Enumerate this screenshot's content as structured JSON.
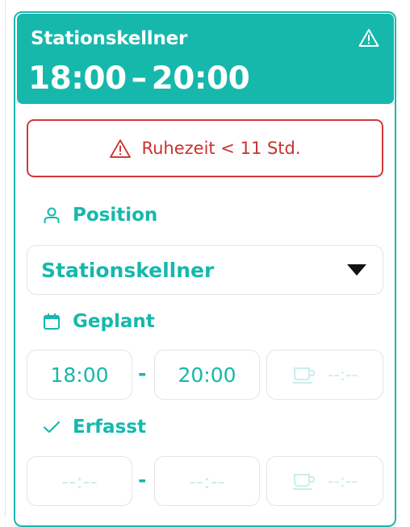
{
  "header": {
    "title": "Stationskellner",
    "time_start": "18:00",
    "time_sep": "–",
    "time_end": "20:00",
    "icon": "warning-icon"
  },
  "alert": {
    "text": "Ruhezeit < 11 Std.",
    "icon": "warning-icon"
  },
  "position": {
    "label": "Position",
    "icon": "person-icon",
    "value": "Stationskellner"
  },
  "planned": {
    "label": "Geplant",
    "icon": "calendar-icon",
    "start": "18:00",
    "sep": "-",
    "end": "20:00",
    "pause_placeholder": "--:--",
    "pause_icon": "coffee-cup-icon"
  },
  "recorded": {
    "label": "Erfasst",
    "icon": "checkmark-icon",
    "start_placeholder": "--:--",
    "sep": "-",
    "end_placeholder": "--:--",
    "pause_placeholder": "--:--",
    "pause_icon": "coffee-cup-icon"
  },
  "colors": {
    "accent": "#16b8ac",
    "alert": "#d3363a",
    "placeholder": "#c9efe9"
  }
}
